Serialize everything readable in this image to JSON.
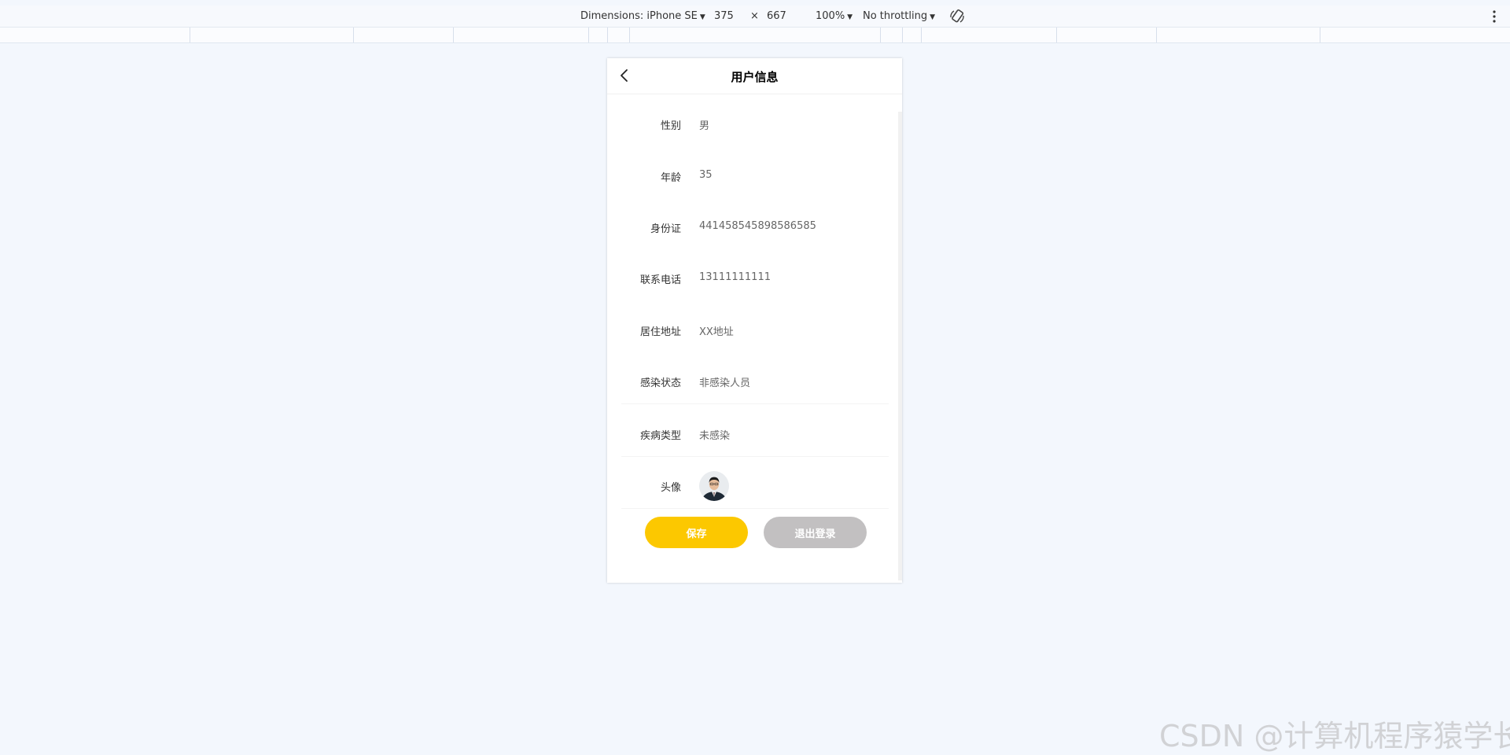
{
  "devtools": {
    "dimensions_label": "Dimensions: iPhone SE",
    "width_value": "375",
    "times": "×",
    "height_value": "667",
    "zoom": "100%",
    "throttling": "No throttling"
  },
  "page": {
    "title": "用户信息",
    "fields": [
      {
        "label": "性别",
        "value": "男"
      },
      {
        "label": "年龄",
        "value": "35"
      },
      {
        "label": "身份证",
        "value": "441458545898586585"
      },
      {
        "label": "联系电话",
        "value": "13111111111"
      },
      {
        "label": "居住地址",
        "value": "XX地址"
      },
      {
        "label": "感染状态",
        "value": "非感染人员"
      },
      {
        "label": "疾病类型",
        "value": "未感染"
      }
    ],
    "avatar_label": "头像",
    "save_label": "保存",
    "logout_label": "退出登录"
  },
  "watermark": "CSDN @计算机程序猿学长",
  "colors": {
    "save_button": "#fcc800",
    "logout_button": "#c2c0c1",
    "background": "#f3f7fd"
  },
  "icons": [
    "chevron-down-icon",
    "rotate-icon",
    "more-vertical-icon",
    "back-arrow-icon"
  ]
}
